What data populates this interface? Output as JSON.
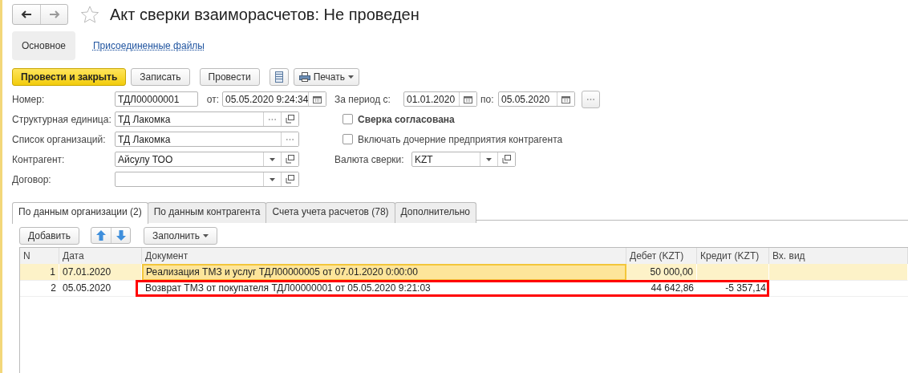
{
  "header": {
    "title": "Акт сверки взаиморасчетов: Не проведен"
  },
  "sections": [
    {
      "label": "Основное",
      "selected": true
    },
    {
      "label": "Присоединенные файлы",
      "selected": false
    }
  ],
  "toolbar": [
    {
      "kind": "primary",
      "label": "Провести и закрыть"
    },
    {
      "kind": "button",
      "label": "Записать"
    },
    {
      "kind": "button",
      "label": "Провести"
    },
    {
      "kind": "list"
    },
    {
      "kind": "print",
      "label": "Печать"
    }
  ],
  "number": {
    "label": "Номер:",
    "value": "ТДЛ00000001",
    "date_label": "от:",
    "date": "05.05.2020  9:24:34"
  },
  "fields": [
    {
      "label": "Структурная единица:",
      "value": "ТД Лакомка",
      "buttons": [
        {
          "kind": "choice"
        },
        {
          "kind": "open"
        }
      ]
    },
    {
      "label": "Список организаций:",
      "value": "ТД Лакомка",
      "buttons": [
        {
          "kind": "choice"
        }
      ]
    },
    {
      "label": "Контрагент:",
      "value": "Айсулу ТОО",
      "buttons": [
        {
          "kind": "dropdown"
        },
        {
          "kind": "open"
        }
      ]
    },
    {
      "label": "Договор:",
      "buttons": [
        {
          "kind": "dropdown"
        },
        {
          "kind": "open"
        }
      ]
    }
  ],
  "period": {
    "label": "За период с:",
    "from": "01.01.2020",
    "to_label": "по:",
    "to": "05.05.2020"
  },
  "checks": [
    {
      "label": "Сверка согласована",
      "checked": false,
      "bold": true
    },
    {
      "label": "Включать дочерние предприятия контрагента",
      "checked": false,
      "bold": false
    }
  ],
  "currency": {
    "label": "Валюта сверки:",
    "value": "KZT"
  },
  "tabs": [
    {
      "label": "По данным организации (2)",
      "selected": true
    },
    {
      "label": "По данным контрагента",
      "selected": false
    },
    {
      "label": "Счета учета расчетов (78)",
      "selected": false
    },
    {
      "label": "Дополнительно",
      "selected": false
    }
  ],
  "table_toolbar": {
    "add": "Добавить",
    "fill": "Заполнить"
  },
  "table": {
    "columns": [
      "N",
      "Дата",
      "Документ",
      "Дебет (KZT)",
      "Кредит (KZT)",
      "Вх. вид"
    ],
    "rows": [
      {
        "selected": true,
        "outlined": false,
        "cells": [
          "1",
          "07.01.2020",
          "Реализация ТМЗ и услуг ТДЛ00000005 от 07.01.2020 0:00:00",
          "50 000,00",
          "",
          ""
        ]
      },
      {
        "selected": false,
        "outlined": true,
        "cells": [
          "2",
          "05.05.2020",
          "Возврат ТМЗ от покупателя ТДЛ00000001 от 05.05.2020 9:21:03",
          "44 642,86",
          "-5 357,14",
          ""
        ]
      }
    ]
  }
}
